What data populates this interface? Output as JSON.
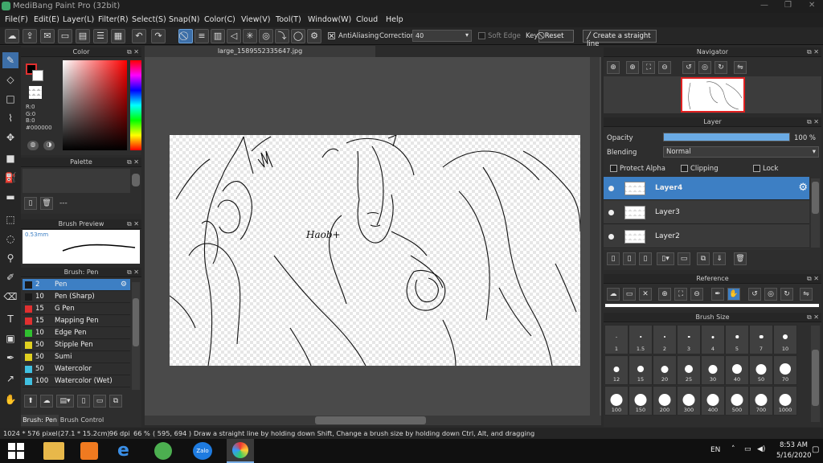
{
  "window": {
    "title": "MediBang Paint Pro (32bit)"
  },
  "menu": [
    "File(F)",
    "Edit(E)",
    "Layer(L)",
    "Filter(R)",
    "Select(S)",
    "Snap(N)",
    "Color(C)",
    "View(V)",
    "Tool(T)",
    "Window(W)",
    "Cloud",
    "Help"
  ],
  "toolbar": {
    "antialiasing_label": "AntiAliasing",
    "correction_label": "Correction",
    "correction_value": "40",
    "soft_edge_label": "Soft Edge",
    "key_label": "Key",
    "reset_label": "Reset",
    "straight_line_label": "Create a straight line"
  },
  "color_panel": {
    "title": "Color",
    "r": "R:0",
    "g": "G:0",
    "b": "B:0",
    "hex": "#000000"
  },
  "palette_panel": {
    "title": "Palette",
    "dashes": "---"
  },
  "brush_preview": {
    "title": "Brush Preview",
    "size": "0.53mm"
  },
  "brush_panel": {
    "title": "Brush: Pen",
    "items": [
      {
        "size": "2",
        "name": "Pen",
        "color": "#1a1a1a",
        "selected": true
      },
      {
        "size": "10",
        "name": "Pen (Sharp)",
        "color": "#1a1a1a"
      },
      {
        "size": "15",
        "name": "G Pen",
        "color": "#e03030"
      },
      {
        "size": "15",
        "name": "Mapping Pen",
        "color": "#e03030"
      },
      {
        "size": "10",
        "name": "Edge Pen",
        "color": "#30c030"
      },
      {
        "size": "50",
        "name": "Stipple Pen",
        "color": "#e0d020"
      },
      {
        "size": "50",
        "name": "Sumi",
        "color": "#e0d020"
      },
      {
        "size": "50",
        "name": "Watercolor",
        "color": "#40c0e0"
      },
      {
        "size": "100",
        "name": "Watercolor (Wet)",
        "color": "#40c0e0"
      }
    ],
    "tabs": [
      "Brush: Pen",
      "Brush Control"
    ]
  },
  "canvas": {
    "tab": "large_1589552335647.jpg",
    "signature": "Haob+"
  },
  "navigator": {
    "title": "Navigator"
  },
  "layer_panel": {
    "title": "Layer",
    "opacity_label": "Opacity",
    "opacity_value": "100 %",
    "opacity_fraction": 1.0,
    "blending_label": "Blending",
    "blending_value": "Normal",
    "protect_alpha": "Protect Alpha",
    "clipping": "Clipping",
    "lock": "Lock",
    "layers": [
      {
        "name": "Layer4",
        "selected": true
      },
      {
        "name": "Layer3"
      },
      {
        "name": "Layer2"
      }
    ]
  },
  "reference": {
    "title": "Reference"
  },
  "brush_size": {
    "title": "Brush Size",
    "sizes": [
      "1",
      "1.5",
      "2",
      "3",
      "4",
      "5",
      "7",
      "10",
      "12",
      "15",
      "20",
      "25",
      "30",
      "40",
      "50",
      "70",
      "100",
      "150",
      "200",
      "300",
      "400",
      "500",
      "700",
      "1000"
    ]
  },
  "status": {
    "dims": "1024 * 576 pixel",
    "cm": "(27.1 * 15.2cm)",
    "dpi": "96 dpi",
    "zoom": "66 %",
    "coords": "( 595, 694 )",
    "hint": "Draw a straight line by holding down Shift, Change a brush size by holding down Ctrl, Alt, and dragging"
  },
  "taskbar": {
    "lang": "EN",
    "time": "8:53 AM",
    "date": "5/16/2020",
    "zalo": "Zalo"
  }
}
